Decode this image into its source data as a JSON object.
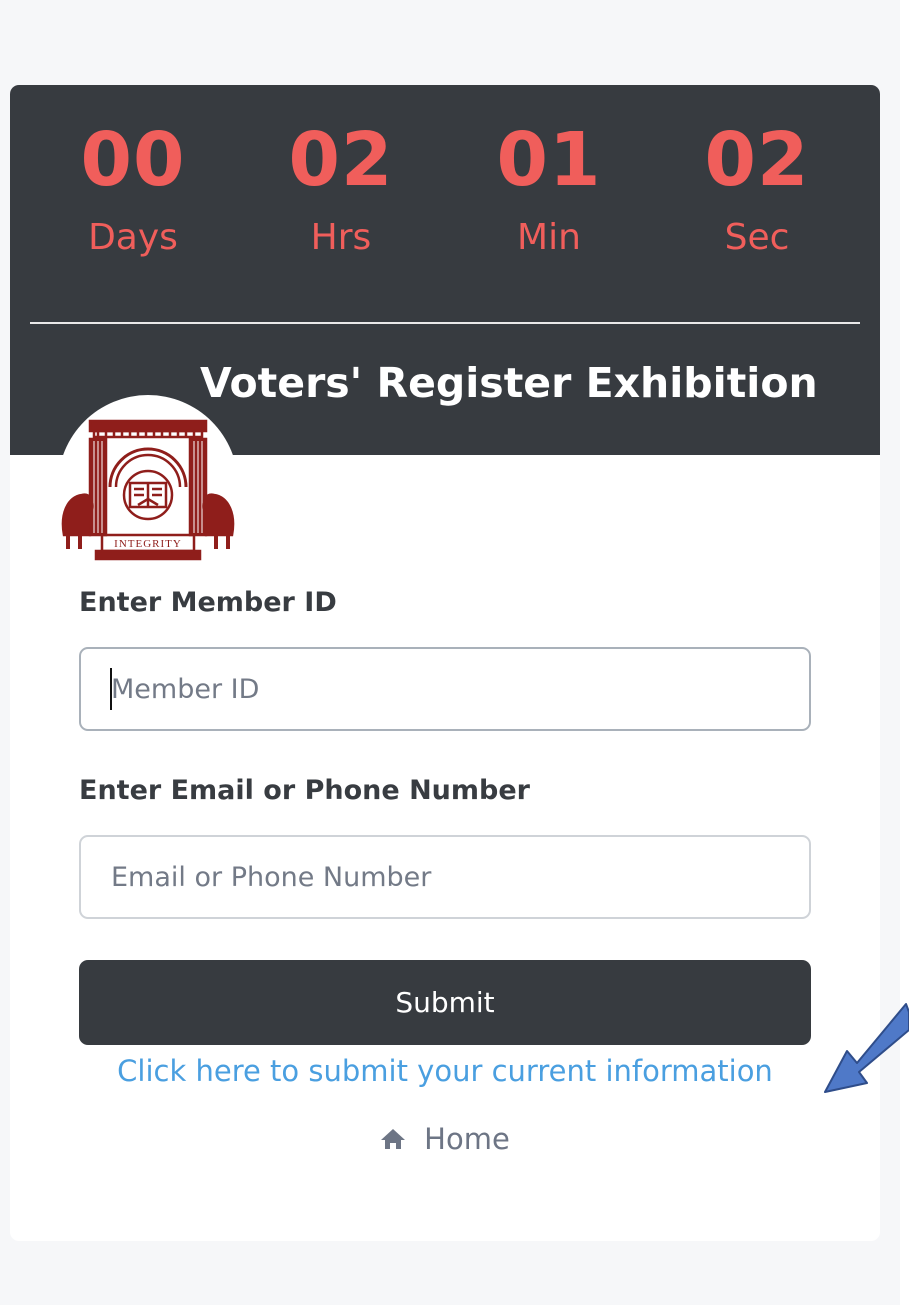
{
  "countdown": {
    "days": {
      "value": "00",
      "label": "Days"
    },
    "hours": {
      "value": "02",
      "label": "Hrs"
    },
    "minutes": {
      "value": "01",
      "label": "Min"
    },
    "seconds": {
      "value": "02",
      "label": "Sec"
    }
  },
  "header": {
    "title": "Voters' Register Exhibition"
  },
  "logo": {
    "icon": "institution-crest-icon",
    "motto": "INTEGRITY"
  },
  "form": {
    "member_id": {
      "label": "Enter Member ID",
      "placeholder": "Member ID",
      "value": ""
    },
    "contact": {
      "label": "Enter Email or Phone Number",
      "placeholder": "Email or Phone Number",
      "value": ""
    },
    "submit_label": "Submit"
  },
  "links": {
    "update_info": "Click here to submit your current information",
    "home": {
      "label": "Home",
      "icon": "home-icon"
    }
  },
  "annotation": {
    "icon": "pointer-arrow-icon",
    "color": "#4f79c8"
  },
  "colors": {
    "header_bg": "#373b40",
    "countdown_accent": "#f05e5b",
    "link": "#4a9fe0",
    "logo": "#8f1e1b"
  }
}
